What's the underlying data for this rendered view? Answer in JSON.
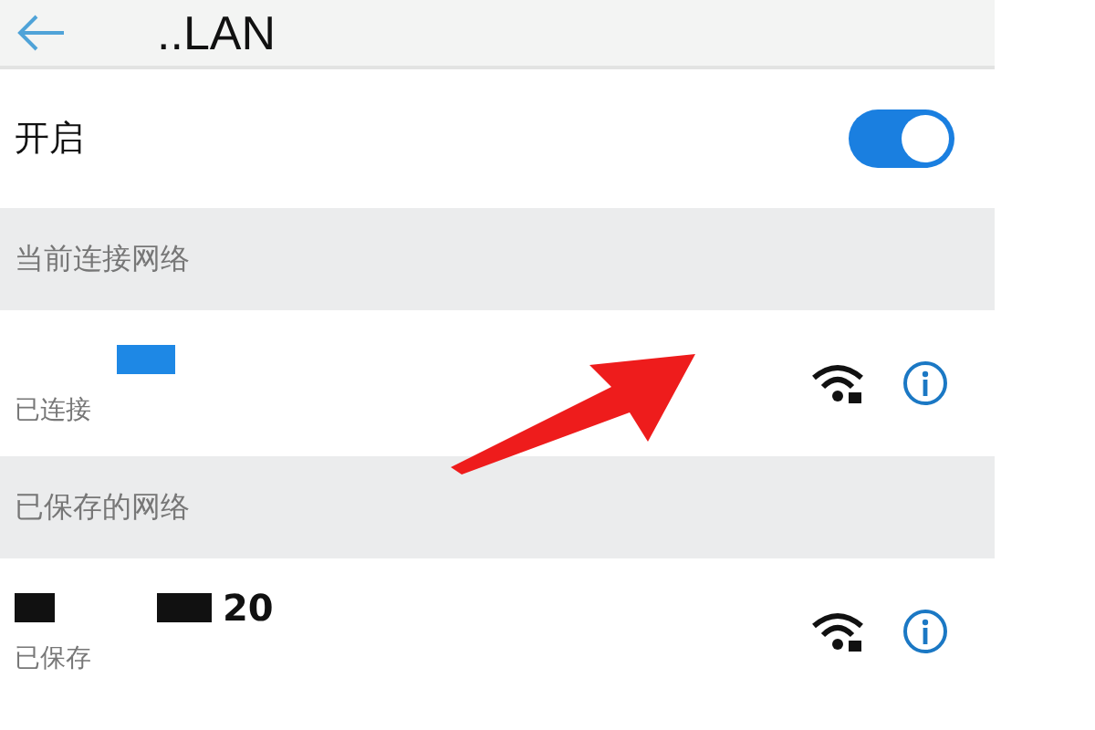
{
  "header": {
    "title": "..LAN"
  },
  "toggle": {
    "label": "开启",
    "on": true
  },
  "sections": [
    {
      "title": "当前连接网络",
      "networks": [
        {
          "status": "已连接"
        }
      ]
    },
    {
      "title": "已保存的网络",
      "networks": [
        {
          "name": "20",
          "status": "已保存"
        }
      ]
    }
  ]
}
